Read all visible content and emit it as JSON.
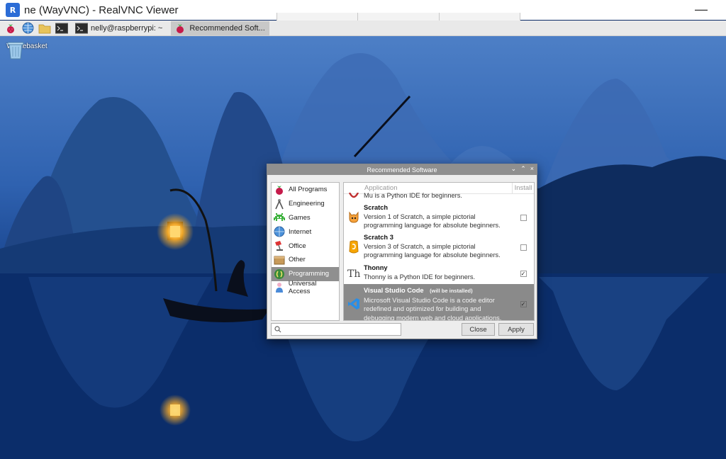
{
  "window": {
    "title": "ne (WayVNC) - RealVNC Viewer",
    "logo_text": "R",
    "minimize_glyph": "—"
  },
  "taskbar": {
    "launchers": [
      {
        "icon": "raspberry-menu-icon"
      },
      {
        "icon": "web-browser-icon"
      },
      {
        "icon": "file-manager-icon"
      },
      {
        "icon": "terminal-icon"
      }
    ],
    "tasks": [
      {
        "label": "nelly@raspberrypi: ~",
        "icon": "terminal-icon"
      },
      {
        "label": "Recommended Soft...",
        "icon": "raspberry-icon"
      }
    ]
  },
  "desktop": {
    "icons": [
      {
        "label": "Wastebasket",
        "icon": "wastebasket-icon"
      }
    ]
  },
  "dialog": {
    "title": "Recommended Software",
    "window_controls": [
      "⌄",
      "⌃",
      "×"
    ],
    "categories": [
      {
        "label": "All Programs",
        "icon": "raspberry-icon",
        "selected": false
      },
      {
        "label": "Engineering",
        "icon": "compass-icon",
        "selected": false
      },
      {
        "label": "Games",
        "icon": "space-invader-icon",
        "selected": false
      },
      {
        "label": "Internet",
        "icon": "globe-icon",
        "selected": false
      },
      {
        "label": "Office",
        "icon": "desk-lamp-icon",
        "selected": false
      },
      {
        "label": "Other",
        "icon": "box-icon",
        "selected": false
      },
      {
        "label": "Programming",
        "icon": "code-icon",
        "selected": true
      },
      {
        "label": "Universal Access",
        "icon": "person-icon",
        "selected": false
      }
    ],
    "table": {
      "col_application": "Application",
      "col_install": "Install"
    },
    "apps": [
      {
        "name": "",
        "desc": "Mu is a Python IDE for beginners.",
        "note": "",
        "icon": "mu-icon",
        "checked": false,
        "selected": false,
        "partial": true
      },
      {
        "name": "Scratch",
        "desc": "Version 1 of Scratch, a simple pictorial programming language for absolute beginners.",
        "note": "",
        "icon": "scratch-cat-icon",
        "checked": false,
        "selected": false
      },
      {
        "name": "Scratch 3",
        "desc": "Version 3 of Scratch, a simple pictorial programming language for absolute beginners.",
        "note": "",
        "icon": "scratch3-icon",
        "checked": false,
        "selected": false
      },
      {
        "name": "Thonny",
        "desc": "Thonny is a Python IDE for beginners.",
        "note": "",
        "icon": "thonny-icon",
        "checked": true,
        "selected": false
      },
      {
        "name": "Visual Studio Code",
        "desc": "Microsoft Visual Studio Code is a code editor redefined and optimized for building and debugging modern web and cloud applications.",
        "note": "(will be installed)",
        "icon": "vscode-icon",
        "checked": true,
        "selected": true
      }
    ],
    "search": {
      "placeholder": "",
      "value": ""
    },
    "buttons": {
      "close": "Close",
      "apply": "Apply"
    }
  },
  "colors": {
    "selection_gray": "#8f8f8f",
    "dialog_bg": "#ededed",
    "wallpaper_dark": "#0b2a66",
    "wallpaper_light": "#5a88cc"
  }
}
